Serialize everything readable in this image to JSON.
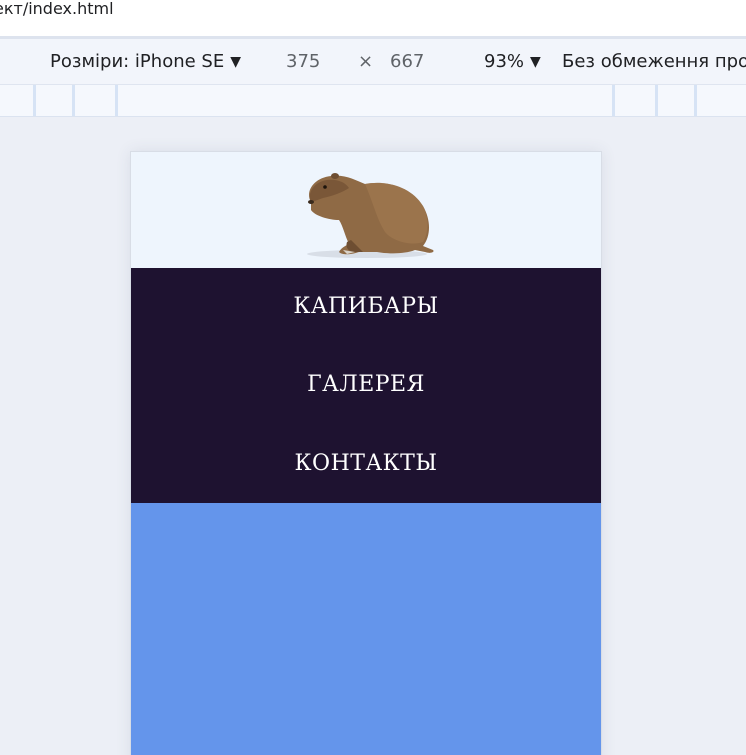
{
  "browser": {
    "url": "ект/index.html"
  },
  "devtools": {
    "dimensions_label": "Розміри: iPhone SE",
    "width": "375",
    "times": "×",
    "height": "667",
    "zoom": "93%",
    "throttle": "Без обмеження про"
  },
  "page": {
    "nav": [
      "КАПИБАРЫ",
      "ГАЛЕРЕЯ",
      "КОНТАКТЫ"
    ]
  },
  "colors": {
    "header_bg": "#eef5fd",
    "nav_bg": "#1e1230",
    "content_bg": "#6495eb"
  }
}
